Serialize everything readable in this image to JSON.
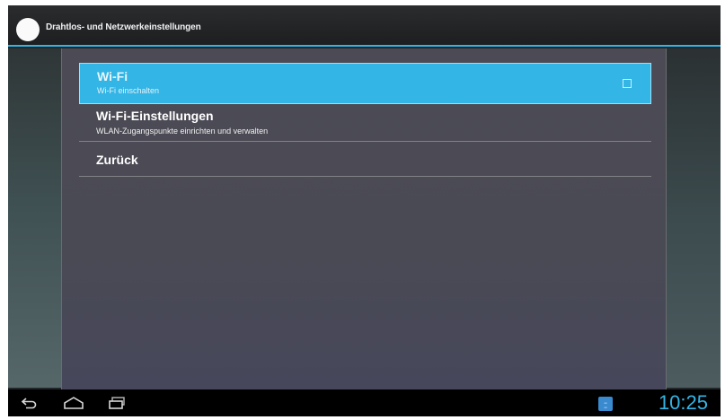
{
  "action_bar": {
    "title": "Drahtlos- und Netzwerkeinstellungen",
    "app_icon": "settings-icon"
  },
  "list": {
    "items": [
      {
        "title": "Wi-Fi",
        "subtitle": "Wi-Fi einschalten",
        "checkbox_checked": false,
        "selected": true
      },
      {
        "title": "Wi-Fi-Einstellungen",
        "subtitle": "WLAN-Zugangspunkte einrichten und verwalten"
      },
      {
        "title": "Zurück"
      }
    ]
  },
  "system_bar": {
    "nav_buttons": [
      "back-icon",
      "home-icon",
      "recent-apps-icon"
    ],
    "clock": "10:25",
    "notification_icon": "notification-app-icon"
  },
  "colors": {
    "accent": "#33b5e5",
    "panel": "#4a4a55",
    "system_bar": "#000000"
  }
}
